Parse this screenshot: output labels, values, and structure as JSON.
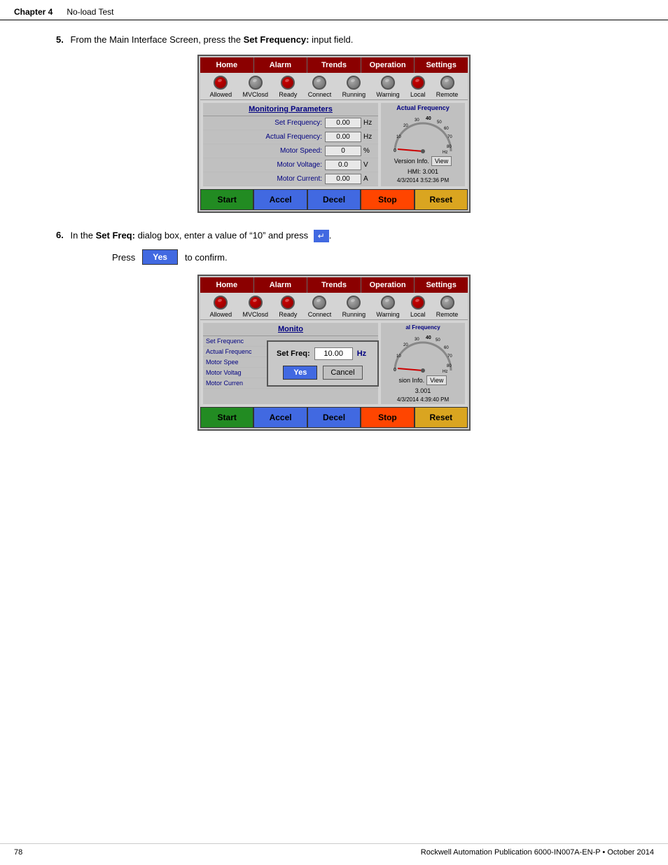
{
  "header": {
    "chapter": "Chapter 4",
    "section": "No-load Test"
  },
  "step5": {
    "number": "5.",
    "text": "From the Main Interface Screen, press the ",
    "bold": "Set Frequency:",
    "text2": " input field."
  },
  "step6": {
    "number": "6.",
    "text": "In the ",
    "bold": "Set Freq:",
    "text2": " dialog box, enter a value of “10” and press",
    "press_confirm": "Press",
    "confirm_text": "to confirm."
  },
  "nav": {
    "items": [
      "Home",
      "Alarm",
      "Trends",
      "Operation",
      "Settings"
    ]
  },
  "status_icons": {
    "items": [
      "Allowed",
      "MVClosd",
      "Ready",
      "Connect",
      "Running",
      "Warning",
      "Local",
      "Remote"
    ]
  },
  "screen1": {
    "monitoring_title": "Monitoring Parameters",
    "params": [
      {
        "label": "Set Frequency:",
        "value": "0.00",
        "unit": "Hz"
      },
      {
        "label": "Actual Frequency:",
        "value": "0.00",
        "unit": "Hz"
      },
      {
        "label": "Motor Speed:",
        "value": "0",
        "unit": "%"
      },
      {
        "label": "Motor Voltage:",
        "value": "0.0",
        "unit": "V"
      },
      {
        "label": "Motor Current:",
        "value": "0.00",
        "unit": "A"
      }
    ],
    "gauge_title": "Actual Frequency",
    "version_label": "Version Info.",
    "view_btn": "View",
    "hmi_label": "HMI:",
    "hmi_value": "3.001",
    "datetime": "4/3/2014 3:52:36 PM",
    "buttons": [
      "Start",
      "Accel",
      "Decel",
      "Stop",
      "Reset"
    ]
  },
  "screen2": {
    "monitoring_title": "Monito",
    "params": [
      {
        "label": "Set Frequenc"
      },
      {
        "label": "Actual Frequenc"
      },
      {
        "label": "Motor Spee"
      },
      {
        "label": "Motor Voltag"
      },
      {
        "label": "Motor Curren"
      }
    ],
    "dialog": {
      "freq_label": "Set Freq:",
      "freq_value": "10.00",
      "freq_unit": "Hz",
      "yes_btn": "Yes",
      "cancel_btn": "Cancel"
    },
    "gauge_title": "al Frequency",
    "version_label": "sion Info.",
    "view_btn": "View",
    "hmi_value": "3.001",
    "datetime": "4/3/2014 4:39:40 PM",
    "buttons": [
      "Start",
      "Accel",
      "Decel",
      "Stop",
      "Reset"
    ]
  },
  "footer": {
    "page": "78",
    "publication": "Rockwell Automation Publication 6000-IN007A-EN-P • October 2014"
  },
  "yes_label": "Yes"
}
